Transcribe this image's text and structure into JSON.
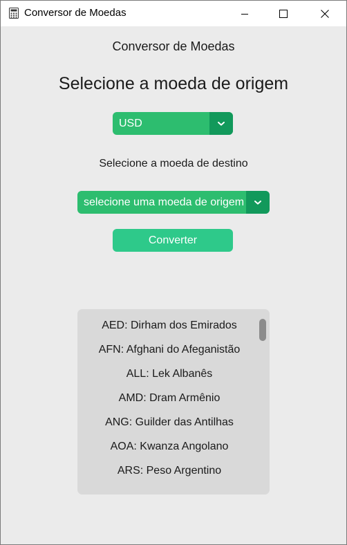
{
  "window": {
    "title": "Conversor de Moedas"
  },
  "header": {
    "title": "Conversor de Moedas"
  },
  "main": {
    "origin_heading": "Selecione a moeda de origem",
    "origin_select": {
      "value": "USD"
    },
    "dest_label": "Selecione a moeda de destino",
    "dest_select": {
      "value": "selecione uma moeda de origem"
    },
    "convert_label": "Converter"
  },
  "currency_list": {
    "items": [
      "AED: Dirham dos Emirados",
      "AFN: Afghani do Afeganistão",
      "ALL: Lek Albanês",
      "AMD: Dram Armênio",
      "ANG: Guilder das Antilhas",
      "AOA: Kwanza Angolano",
      "ARS: Peso Argentino"
    ]
  },
  "colors": {
    "select_bg": "#2dbd6f",
    "select_arrow_bg": "#12995b",
    "button_bg": "#2ec98a",
    "list_bg": "#d9d9d9",
    "window_bg": "#ebebeb"
  },
  "icons": {
    "app": "calculator-icon",
    "minimize": "minimize-icon",
    "maximize": "maximize-icon",
    "close": "close-icon",
    "dropdown": "chevron-down-icon"
  }
}
